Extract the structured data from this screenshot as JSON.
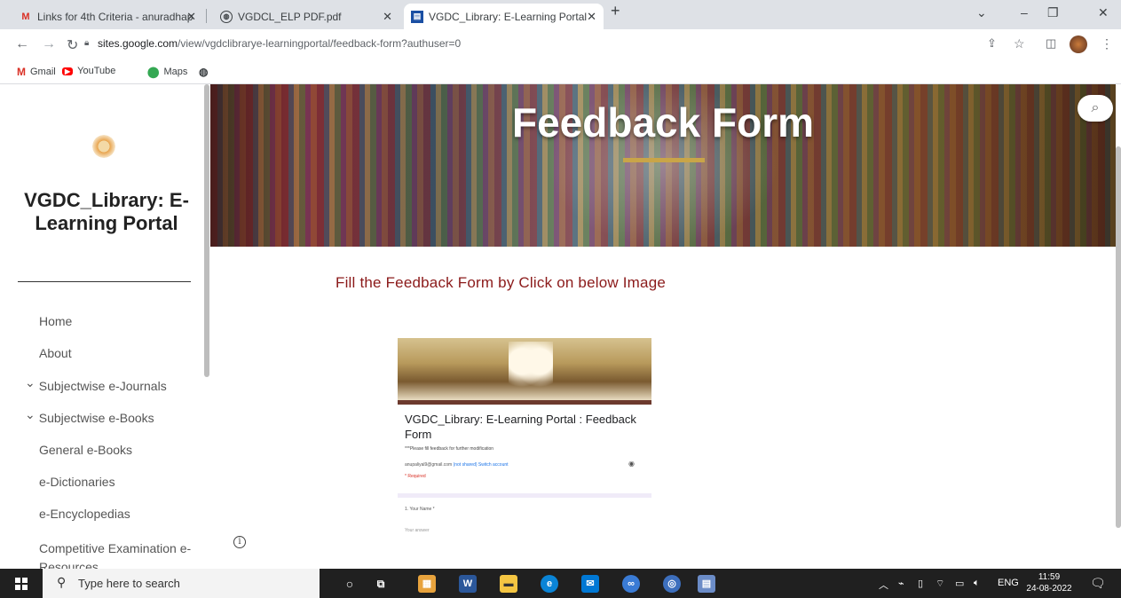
{
  "browser": {
    "tabs": [
      {
        "label": "Links for 4th Criteria - anuradhap",
        "icon": "gmail-icon"
      },
      {
        "label": "VGDCL_ELP PDF.pdf",
        "icon": "web-icon"
      },
      {
        "label": "VGDC_Library: E-Learning Portal",
        "icon": "sites-icon"
      }
    ],
    "new_tab": "+",
    "url_host": "sites.google.com",
    "url_path": "/view/vgdclibrarye-learningportal/feedback-form?authuser=0",
    "bookmarks": [
      {
        "label": "Gmail",
        "icon": "gmail-icon"
      },
      {
        "label": "YouTube",
        "icon": "youtube-icon"
      },
      {
        "label": "Maps",
        "icon": "maps-icon"
      }
    ]
  },
  "sidebar": {
    "title": "VGDC_Library: E-Learning Portal",
    "items": [
      {
        "label": "Home"
      },
      {
        "label": "About"
      },
      {
        "label": "Subjectwise e-Journals"
      },
      {
        "label": "Subjectwise e-Books"
      },
      {
        "label": "General e-Books"
      },
      {
        "label": "e-Dictionaries"
      },
      {
        "label": "e-Encyclopedias"
      },
      {
        "label": "Competitive Examination e-Resources"
      }
    ]
  },
  "banner": {
    "title": "Feedback Form"
  },
  "main": {
    "instruction": "Fill the Feedback Form by Click on below Image",
    "form_preview": {
      "title": "VGDC_Library: E-Learning Portal : Feedback Form",
      "description": "***Please fill feedback for further modification",
      "email": "anupaliyal9@gmail.com",
      "email_link": "(not shared) Switch account",
      "required_note": "* Required",
      "question": "1. Your Name *",
      "answer_placeholder": "Your answer"
    }
  },
  "taskbar": {
    "search_placeholder": "Type here to search",
    "language": "ENG",
    "time": "11:59",
    "date": "24-08-2022"
  },
  "colors": {
    "instruction": "#8b1a1a",
    "banner_rule": "#c9a548",
    "form_accent": "#6d3a2e"
  }
}
